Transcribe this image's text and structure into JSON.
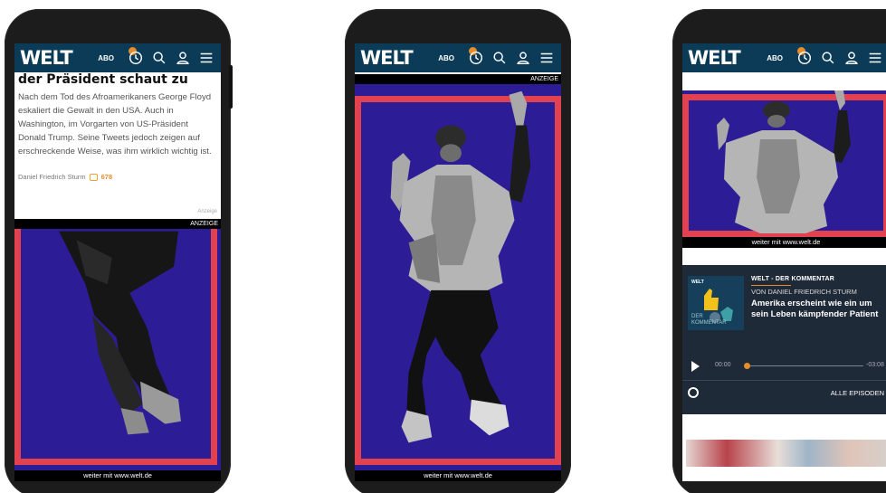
{
  "colors": {
    "header_bg": "#0b3b56",
    "ad_bg": "#2c1d97",
    "ad_frame": "#e2414f",
    "accent": "#e58c2b",
    "podcast_bg": "#1f2a38"
  },
  "header": {
    "logo": "WELT",
    "abo_label": "ABO",
    "icons": [
      "history-icon",
      "search-icon",
      "user-icon",
      "menu-icon"
    ]
  },
  "phone1": {
    "headline": "der Präsident schaut zu",
    "teaser": "Nach dem Tod des Afroamerikaners George Floyd eskaliert die Gewalt in den USA. Auch in Washington, im Vorgarten von US-Präsident Donald Trump. Seine Tweets jedoch zeigen auf erschreckende Weise, was ihm wirklich wichtig ist.",
    "author": "Daniel Friedrich Sturm",
    "comments": "678",
    "ad_small_label": "Anzeige",
    "ad_bar_label": "ANZEIGE",
    "ad_footer": "weiter mit www.welt.de"
  },
  "phone2": {
    "ad_bar_label": "ANZEIGE",
    "ad_footer": "weiter mit www.welt.de"
  },
  "phone3": {
    "ad_footer": "weiter mit www.welt.de",
    "podcast": {
      "cover_brand": "WELT",
      "cover_title_1": "DER",
      "cover_title_2": "KOMMENTAR",
      "kicker": "WELT - DER KOMMENTAR",
      "author": "VON DANIEL FRIEDRICH STURM",
      "title": "Amerika erscheint wie ein um sein Leben kämpfender Patient",
      "time_elapsed": "00:00",
      "time_remaining": "-03:08",
      "progress": 0,
      "all_episodes": "ALLE EPISODEN"
    }
  }
}
